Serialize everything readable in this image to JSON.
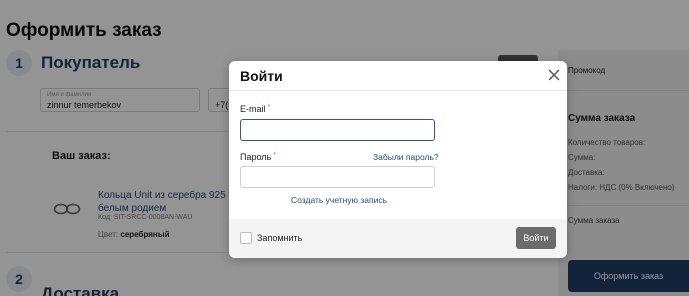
{
  "page": {
    "title": "Оформить заказ",
    "step1": {
      "num": "1",
      "title": "Покупатель"
    },
    "step2": {
      "num": "2",
      "title": "Доставка"
    },
    "name_field": {
      "label": "Имя и фамилия",
      "value": "zinnur temerbekov"
    },
    "phone_field": {
      "value": "+7("
    },
    "order": {
      "heading": "Ваш заказ:",
      "product_name": "Кольца Unit из серебра 925 с п… белым родием",
      "product_code": "Код: SIT-SRCC-0008AN-WAU",
      "color_label": "Цвет:",
      "color_value": "серебряный"
    }
  },
  "sidebar": {
    "promo_label": "Промокод",
    "sum_heading": "Сумма заказа",
    "lines": [
      "Количество товаров:",
      "Сумма:",
      "Доставка:",
      "Налоги: НДС (0% Включено)"
    ],
    "total_label": "Сумма заказа",
    "order_button": "Оформить заказ"
  },
  "modal": {
    "title": "Войти",
    "email_label": "E-mail",
    "required_mark": "*",
    "email_value": "",
    "password_label": "Пароль",
    "password_value": "",
    "forgot_link": "Забыли пароль?",
    "create_account_link": "Создать учетную запись",
    "remember_label": "Запомнить",
    "submit_label": "Войти"
  },
  "colors": {
    "accent": "#1f3f66",
    "link": "#1f4d7a",
    "required": "#d9534f",
    "submit_button": "#6b6b6b"
  },
  "icons": {
    "close": "close-icon",
    "product": "ring-icon"
  }
}
